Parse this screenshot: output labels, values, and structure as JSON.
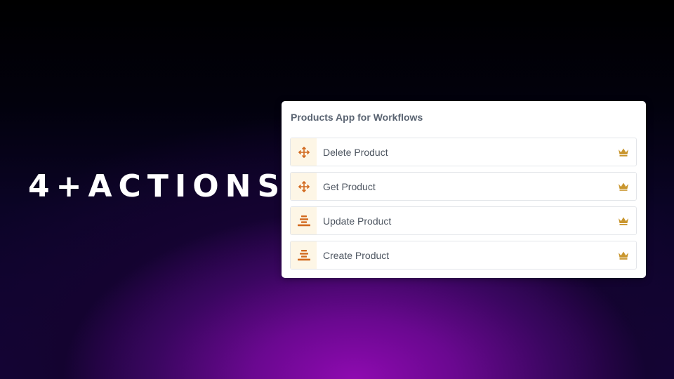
{
  "headline": "4+ACTIONS",
  "card": {
    "title": "Products App for Workflows",
    "actions": [
      {
        "label": "Delete Product",
        "icon": "move-arrows-icon",
        "badge": "crown-icon"
      },
      {
        "label": "Get Product",
        "icon": "move-arrows-icon",
        "badge": "crown-icon"
      },
      {
        "label": "Update Product",
        "icon": "stack-bars-icon",
        "badge": "crown-icon"
      },
      {
        "label": "Create Product",
        "icon": "stack-bars-icon",
        "badge": "crown-icon"
      }
    ]
  },
  "colors": {
    "icon_orange": "#d2691e",
    "crown_gold": "#c9962e",
    "icon_bg": "#fdf6e6",
    "accent_purple": "#8e0ab0"
  }
}
